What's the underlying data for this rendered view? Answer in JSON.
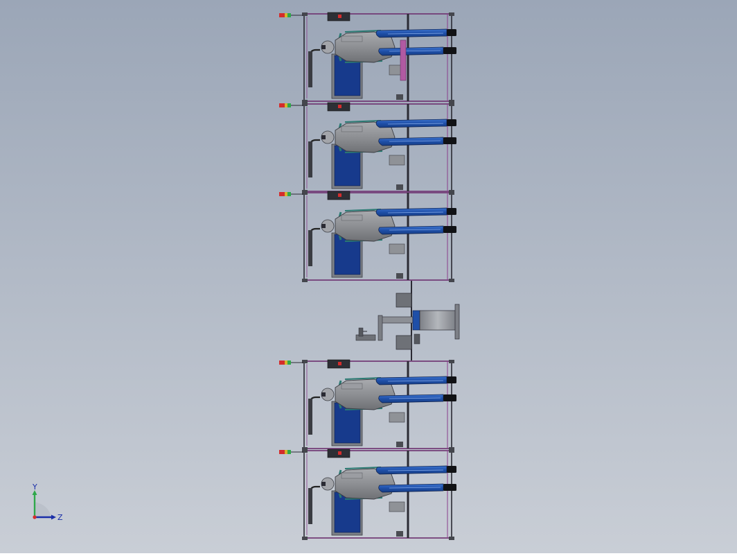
{
  "viewport": {
    "background_top": "#9ba6b7",
    "background_bottom": "#c9ced6"
  },
  "colors": {
    "frame": "#2a2a33",
    "frame_accent": "#8a3d8c",
    "arm_blue": "#1f4fa8",
    "arm_blue_light": "#3d74cf",
    "body_gray": "#8d8f93",
    "panel_blue": "#173a8c",
    "panel_gray": "#7c8087",
    "teal": "#2b7a72",
    "pink": "#b05aa2",
    "lamp_red": "#d42c2c",
    "lamp_yellow": "#d8b52a",
    "lamp_green": "#2fa84a"
  },
  "triad": {
    "y_label": "Y",
    "z_label": "Z",
    "icon": "coordinate-triad-icon"
  }
}
